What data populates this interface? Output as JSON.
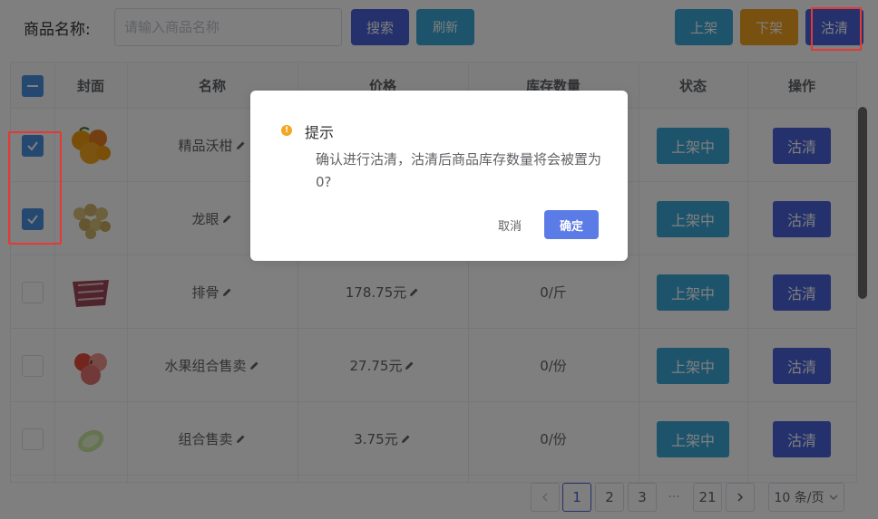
{
  "toolbar": {
    "search_label": "商品名称:",
    "search_placeholder": "请输入商品名称",
    "search_button": "搜索",
    "refresh_button": "刷新",
    "up_button": "上架",
    "down_button": "下架",
    "clear_button": "沽清"
  },
  "table": {
    "headers": [
      "封面",
      "名称",
      "价格",
      "库存数量",
      "状态",
      "操作"
    ],
    "rows": [
      {
        "checked": true,
        "image": "oranges",
        "name": "精品沃柑",
        "price": "",
        "stock": "",
        "status": "上架中",
        "action": "沽清"
      },
      {
        "checked": true,
        "image": "longan",
        "name": "龙眼",
        "price": "",
        "stock": "",
        "status": "上架中",
        "action": "沽清"
      },
      {
        "checked": false,
        "image": "ribs",
        "name": "排骨",
        "price": "178.75元",
        "stock": "0/斤",
        "status": "上架中",
        "action": "沽清"
      },
      {
        "checked": false,
        "image": "apples",
        "name": "水果组合售卖",
        "price": "27.75元",
        "stock": "0/份",
        "status": "上架中",
        "action": "沽清"
      },
      {
        "checked": false,
        "image": "cabbage",
        "name": "组合售卖",
        "price": "3.75元",
        "stock": "0/份",
        "status": "上架中",
        "action": "沽清"
      }
    ]
  },
  "pagination": {
    "prev_icon": "chevron-left-icon",
    "pages": [
      "1",
      "2",
      "3"
    ],
    "current": "1",
    "ellipsis": "···",
    "last": "21",
    "next_icon": "chevron-right-icon",
    "page_size": "10 条/页"
  },
  "dialog": {
    "title": "提示",
    "icon": "warning-icon",
    "message": "确认进行沽清，沽清后商品库存数量将会被置为0?",
    "cancel": "取消",
    "confirm": "确定"
  },
  "colors": {
    "primary": "#4a63d8",
    "info": "#3aa8d8",
    "warning": "#f0a020",
    "highlight": "#e53935"
  }
}
